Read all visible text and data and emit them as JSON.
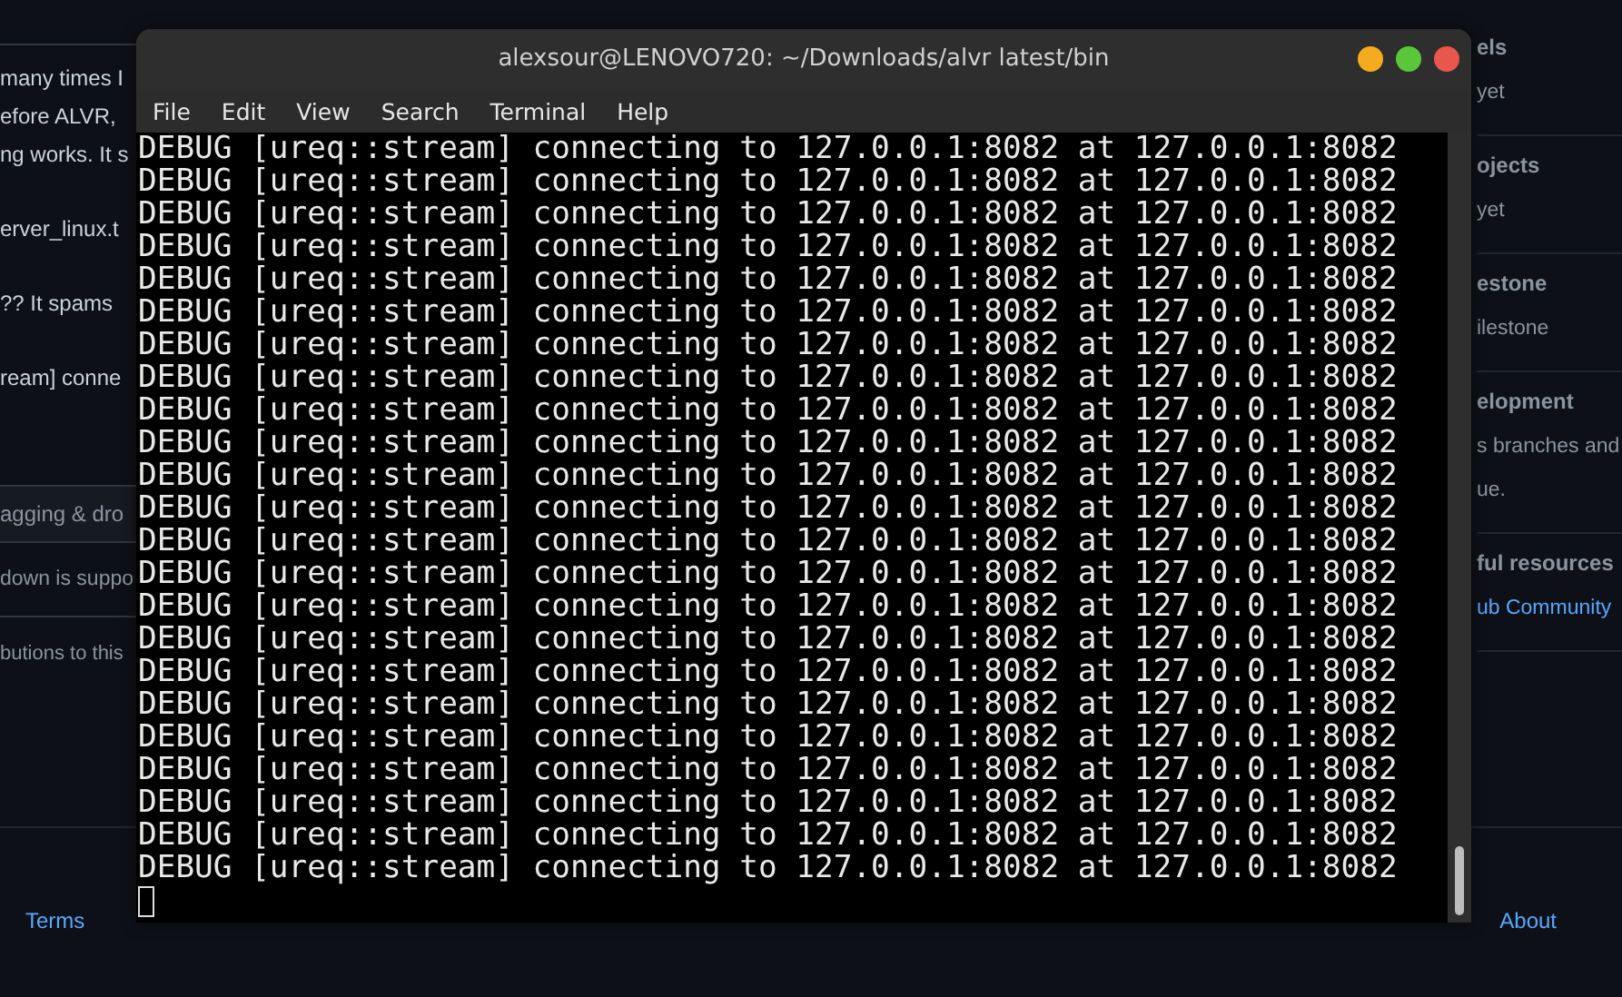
{
  "page": {
    "editor_paragraphs": [
      [
        "many times I",
        "efore ALVR,",
        "ng works. It s"
      ],
      [
        "erver_linux.t"
      ],
      [
        "?? It spams"
      ],
      [
        "ream] conne"
      ]
    ],
    "attach_hint": "agging & dro",
    "markdown_note": "down is suppo",
    "contrib_note": "butions to this",
    "sidebar": [
      {
        "heading": "els",
        "lines": [
          "yet"
        ],
        "kind": "text"
      },
      {
        "heading": "ojects",
        "lines": [
          "yet"
        ],
        "kind": "text"
      },
      {
        "heading": "estone",
        "lines": [
          "ilestone"
        ],
        "kind": "text"
      },
      {
        "heading": "elopment",
        "lines": [
          "s branches and",
          "ue."
        ],
        "kind": "text"
      },
      {
        "heading": "ful resources",
        "lines": [
          "ub Community"
        ],
        "kind": "link"
      }
    ],
    "footer": {
      "left": "Terms",
      "right": "About"
    }
  },
  "terminal": {
    "title": "alexsour@LENOVO720: ~/Downloads/alvr latest/bin",
    "menu": [
      "File",
      "Edit",
      "View",
      "Search",
      "Terminal",
      "Help"
    ],
    "lines": [
      "DEBUG [ureq::stream] connecting to 127.0.0.1:8082 at 127.0.0.1:8082",
      "DEBUG [ureq::stream] connecting to 127.0.0.1:8082 at 127.0.0.1:8082",
      "DEBUG [ureq::stream] connecting to 127.0.0.1:8082 at 127.0.0.1:8082",
      "DEBUG [ureq::stream] connecting to 127.0.0.1:8082 at 127.0.0.1:8082",
      "DEBUG [ureq::stream] connecting to 127.0.0.1:8082 at 127.0.0.1:8082",
      "DEBUG [ureq::stream] connecting to 127.0.0.1:8082 at 127.0.0.1:8082",
      "DEBUG [ureq::stream] connecting to 127.0.0.1:8082 at 127.0.0.1:8082",
      "DEBUG [ureq::stream] connecting to 127.0.0.1:8082 at 127.0.0.1:8082",
      "DEBUG [ureq::stream] connecting to 127.0.0.1:8082 at 127.0.0.1:8082",
      "DEBUG [ureq::stream] connecting to 127.0.0.1:8082 at 127.0.0.1:8082",
      "DEBUG [ureq::stream] connecting to 127.0.0.1:8082 at 127.0.0.1:8082",
      "DEBUG [ureq::stream] connecting to 127.0.0.1:8082 at 127.0.0.1:8082",
      "DEBUG [ureq::stream] connecting to 127.0.0.1:8082 at 127.0.0.1:8082",
      "DEBUG [ureq::stream] connecting to 127.0.0.1:8082 at 127.0.0.1:8082",
      "DEBUG [ureq::stream] connecting to 127.0.0.1:8082 at 127.0.0.1:8082",
      "DEBUG [ureq::stream] connecting to 127.0.0.1:8082 at 127.0.0.1:8082",
      "DEBUG [ureq::stream] connecting to 127.0.0.1:8082 at 127.0.0.1:8082",
      "DEBUG [ureq::stream] connecting to 127.0.0.1:8082 at 127.0.0.1:8082",
      "DEBUG [ureq::stream] connecting to 127.0.0.1:8082 at 127.0.0.1:8082",
      "DEBUG [ureq::stream] connecting to 127.0.0.1:8082 at 127.0.0.1:8082",
      "DEBUG [ureq::stream] connecting to 127.0.0.1:8082 at 127.0.0.1:8082",
      "DEBUG [ureq::stream] connecting to 127.0.0.1:8082 at 127.0.0.1:8082",
      "DEBUG [ureq::stream] connecting to 127.0.0.1:8082 at 127.0.0.1:8082"
    ]
  }
}
